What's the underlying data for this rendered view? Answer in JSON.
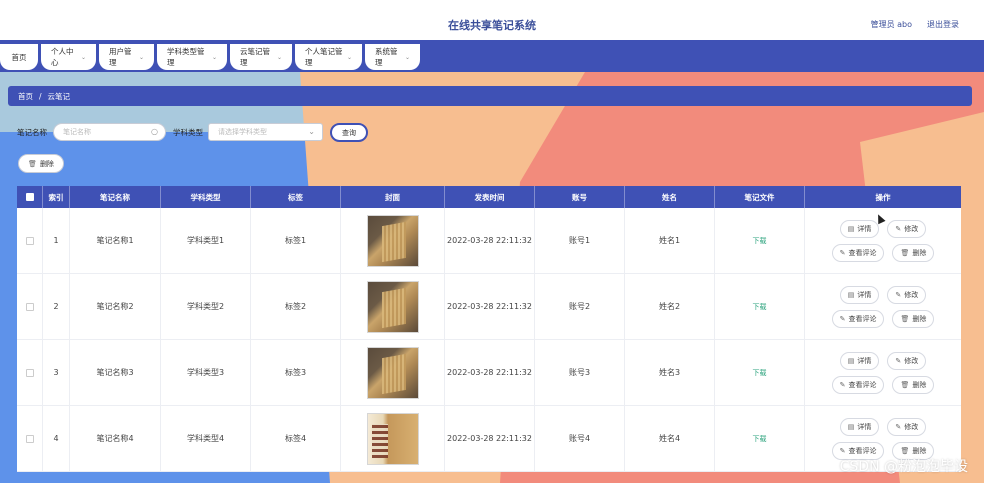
{
  "header": {
    "title": "在线共享笔记系统",
    "user": "管理员 abo",
    "logout": "退出登录"
  },
  "nav": {
    "tabs": [
      {
        "label": "首页",
        "has_menu": false
      },
      {
        "label": "个人中心",
        "has_menu": true
      },
      {
        "label": "用户管理",
        "has_menu": true
      },
      {
        "label": "学科类型管理",
        "has_menu": true
      },
      {
        "label": "云笔记管理",
        "has_menu": true
      },
      {
        "label": "个人笔记管理",
        "has_menu": true
      },
      {
        "label": "系统管理",
        "has_menu": true
      }
    ]
  },
  "breadcrumb": {
    "home": "首页",
    "sep": "/",
    "current": "云笔记"
  },
  "search": {
    "name_label": "笔记名称",
    "name_placeholder": "笔记名称",
    "type_label": "学科类型",
    "type_placeholder": "请选择学科类型",
    "query_label": "查询",
    "delete_label": "删除"
  },
  "table": {
    "headers": [
      "",
      "索引",
      "笔记名称",
      "学科类型",
      "标签",
      "封面",
      "发表时间",
      "账号",
      "姓名",
      "笔记文件",
      "操作"
    ],
    "rows": [
      {
        "index": "1",
        "name": "笔记名称1",
        "type": "学科类型1",
        "tag": "标签1",
        "time": "2022-03-28 22:11:32",
        "account": "账号1",
        "realname": "姓名1",
        "file": "下载",
        "cover": "book-cover-image"
      },
      {
        "index": "2",
        "name": "笔记名称2",
        "type": "学科类型2",
        "tag": "标签2",
        "time": "2022-03-28 22:11:32",
        "account": "账号2",
        "realname": "姓名2",
        "file": "下载",
        "cover": "book-cover-image"
      },
      {
        "index": "3",
        "name": "笔记名称3",
        "type": "学科类型3",
        "tag": "标签3",
        "time": "2022-03-28 22:11:32",
        "account": "账号3",
        "realname": "姓名3",
        "file": "下载",
        "cover": "book-cover-image"
      },
      {
        "index": "4",
        "name": "笔记名称4",
        "type": "学科类型4",
        "tag": "标签4",
        "time": "2022-03-28 22:11:32",
        "account": "账号4",
        "realname": "姓名4",
        "file": "下载",
        "cover": "book-cover-image"
      }
    ],
    "actions": {
      "detail": "详情",
      "edit": "修改",
      "comments": "查看评论",
      "delete": "删除"
    }
  },
  "watermark": "CSDN @粉泡泡毕设",
  "colors": {
    "primary": "#3f51b5",
    "bg_blue": "#5b8fe6",
    "bg_orange": "#f7be90",
    "bg_salmon": "#f28b7c",
    "download": "#2aa27c"
  },
  "icons": {
    "search": "magnifier-icon",
    "chevron": "chevron-down-icon",
    "delete": "trash-icon",
    "detail": "document-icon",
    "edit": "pencil-icon"
  }
}
